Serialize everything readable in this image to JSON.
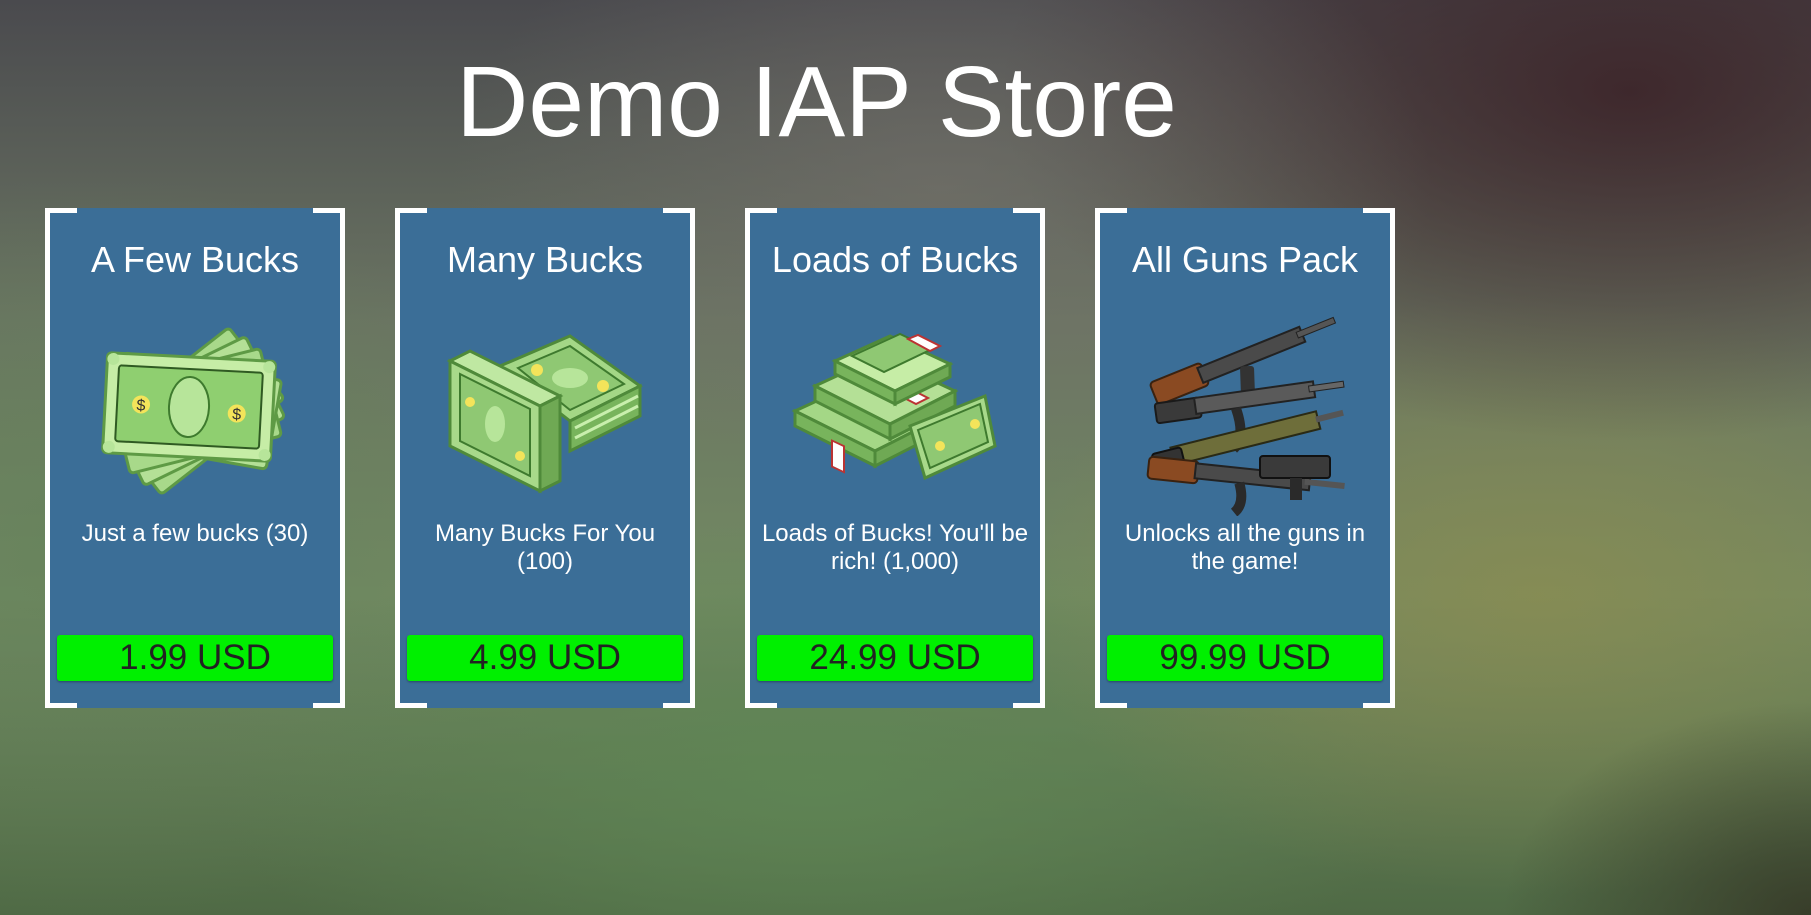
{
  "store": {
    "title": "Demo IAP Store"
  },
  "products": [
    {
      "title": "A Few Bucks",
      "description": "Just a few bucks (30)",
      "price": "1.99 USD",
      "icon": "cash-fan-icon"
    },
    {
      "title": "Many Bucks",
      "description": "Many Bucks For You (100)",
      "price": "4.99 USD",
      "icon": "cash-stacks-icon"
    },
    {
      "title": "Loads of Bucks",
      "description": "Loads of Bucks! You'll be rich! (1,000)",
      "price": "24.99 USD",
      "icon": "cash-bundles-icon"
    },
    {
      "title": "All Guns Pack",
      "description": "Unlocks all the guns in the game!",
      "price": "99.99 USD",
      "icon": "guns-pile-icon"
    }
  ],
  "colors": {
    "card_background": "#3b6e97",
    "button_background": "#00f000",
    "button_text": "#222222",
    "frame": "#ffffff"
  }
}
